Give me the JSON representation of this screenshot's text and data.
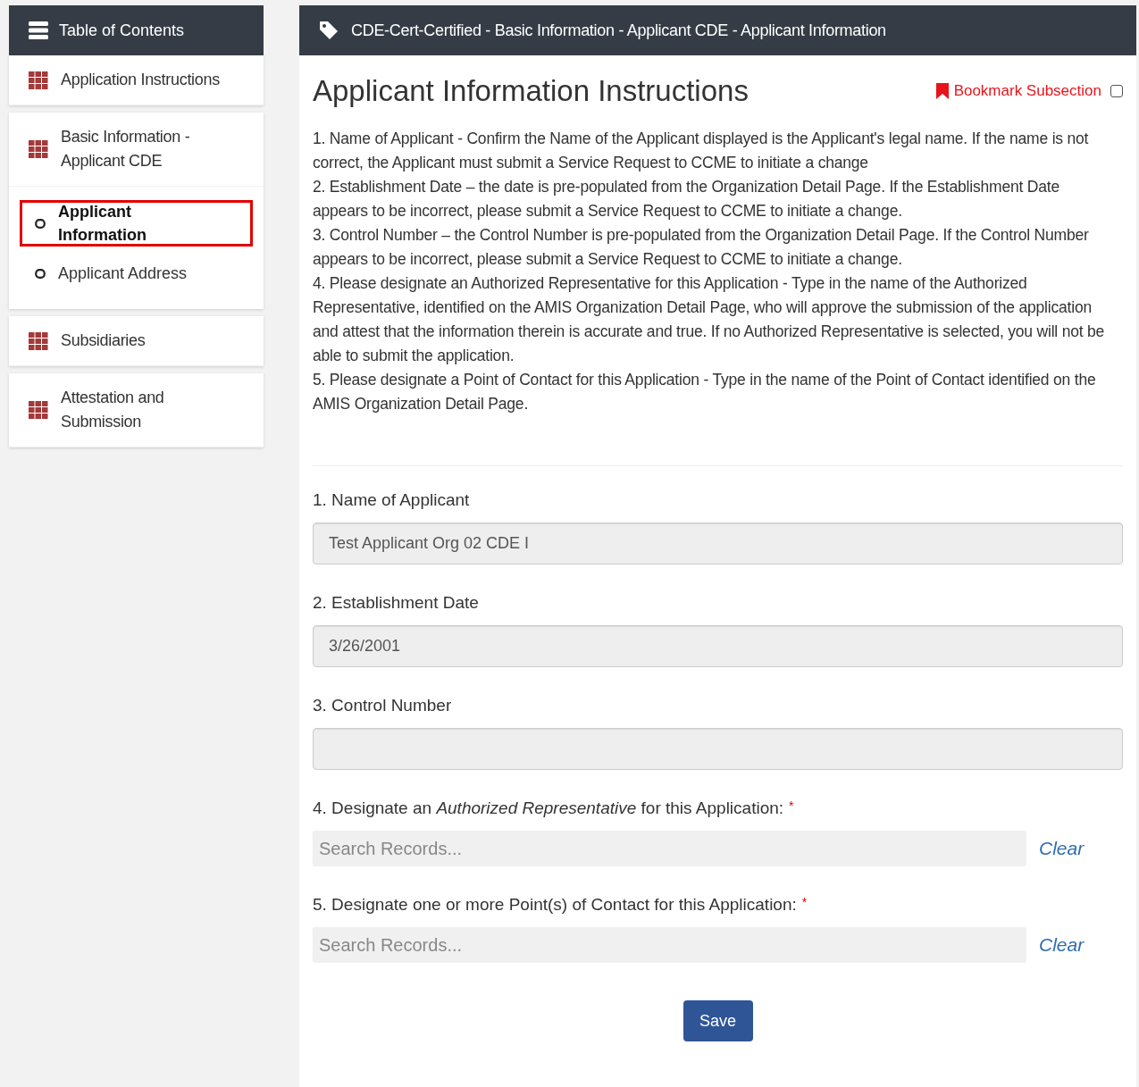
{
  "toc": {
    "title": "Table of Contents",
    "sections": [
      {
        "label": "Application Instructions"
      },
      {
        "label": "Basic Information - Applicant CDE",
        "children": [
          {
            "label": "Applicant Information",
            "selected": true
          },
          {
            "label": "Applicant Address",
            "selected": false
          }
        ]
      },
      {
        "label": "Subsidiaries"
      },
      {
        "label": "Attestation and Submission"
      }
    ]
  },
  "header": {
    "breadcrumb": "CDE-Cert-Certified - Basic Information - Applicant CDE - Applicant Information"
  },
  "heading": "Applicant Information Instructions",
  "bookmark": {
    "label": "Bookmark Subsection",
    "checked": false
  },
  "instructions": [
    "1. Name of Applicant - Confirm the Name of the Applicant displayed is the Applicant's legal name.  If the name is not correct, the Applicant must submit a Service Request to CCME to initiate a change",
    "2. Establishment Date – the date is pre-populated from the Organization Detail Page. If the Establishment Date appears to be incorrect, please submit a Service Request to CCME to initiate a change.",
    "3. Control Number – the Control Number is pre-populated from the Organization Detail Page. If the Control Number appears to be incorrect, please submit a Service Request to CCME to initiate a change.",
    "4. Please designate an Authorized Representative for this Application - Type in the name of the Authorized Representative, identified on the AMIS Organization Detail Page, who will approve the submission of the application and attest that the information therein is accurate and true. If no Authorized Representative is selected, you will not be able to submit the application.",
    "5. Please designate a Point of Contact for this Application - Type in the name of the Point of Contact identified on the AMIS Organization Detail Page."
  ],
  "fields": [
    {
      "kind": "readonly",
      "label": "1. Name of Applicant",
      "value": "Test Applicant Org 02 CDE I"
    },
    {
      "kind": "readonly",
      "label": "2. Establishment Date",
      "value": "3/26/2001"
    },
    {
      "kind": "readonly",
      "label": "3. Control Number"
    },
    {
      "kind": "search",
      "label": "4. Designate an *Authorized Representative* for this Application:",
      "required_mark": "*",
      "placeholder": "Search Records...",
      "action": "Clear"
    },
    {
      "kind": "search",
      "label": "5. Designate one or more Point(s) of Contact for this Application:",
      "required_mark": "*",
      "placeholder": "Search Records...",
      "action": "Clear"
    }
  ],
  "save": "Save"
}
